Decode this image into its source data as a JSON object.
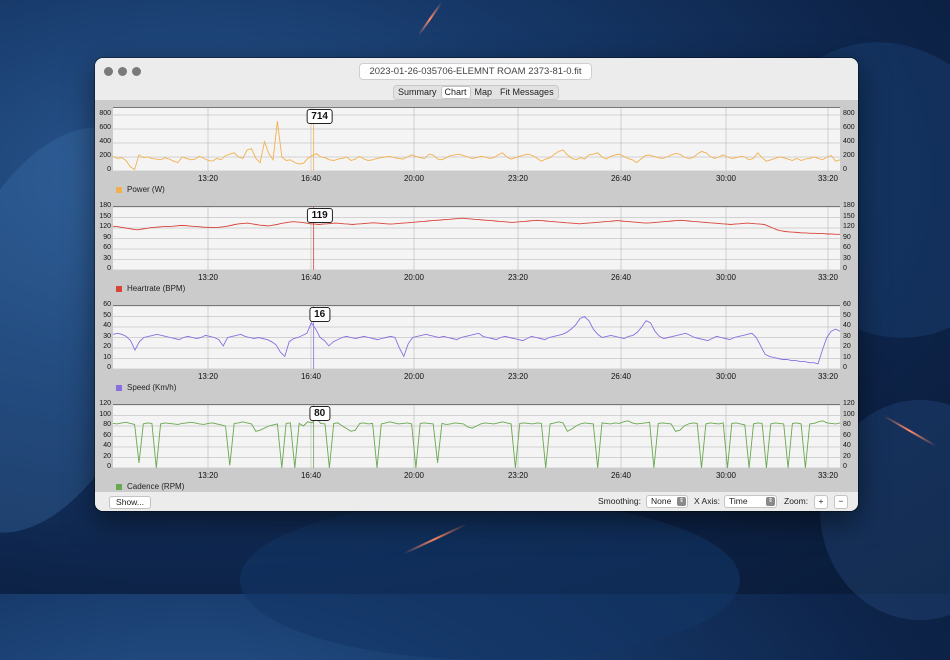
{
  "window": {
    "filename": "2023-01-26-035706-ELEMNT ROAM 2373-81-0.fit",
    "tabs": [
      {
        "label": "Summary",
        "selected": false
      },
      {
        "label": "Chart",
        "selected": true
      },
      {
        "label": "Map",
        "selected": false
      },
      {
        "label": "Fit Messages",
        "selected": false
      }
    ]
  },
  "charts": [
    {
      "key": "power",
      "legend": "Power (W)",
      "color": "#f2b14f",
      "yticks": [
        "800",
        "600",
        "400",
        "200",
        "0"
      ],
      "ymax": 900,
      "callout": "714",
      "xticks": [
        "13:20",
        "16:40",
        "20:00",
        "23:20",
        "26:40",
        "30:00",
        "33:20"
      ],
      "series": [
        210,
        180,
        190,
        150,
        60,
        20,
        230,
        190,
        200,
        180,
        170,
        160,
        190,
        170,
        140,
        120,
        200,
        180,
        160,
        170,
        210,
        180,
        150,
        140,
        180,
        160,
        220,
        240,
        260,
        200,
        180,
        300,
        320,
        180,
        120,
        420,
        250,
        160,
        714,
        200,
        150,
        160,
        120,
        100,
        110,
        180,
        220,
        250,
        200,
        190,
        160,
        150,
        170,
        180,
        200,
        150,
        170,
        210,
        170,
        150,
        160,
        180,
        190,
        200,
        210,
        190,
        180,
        170,
        200,
        230,
        210,
        190,
        180,
        240,
        230,
        170,
        160,
        190,
        220,
        230,
        240,
        220,
        200,
        180,
        190,
        210,
        200,
        180,
        190,
        230,
        260,
        200,
        170,
        190,
        210,
        230,
        240,
        220,
        180,
        140,
        170,
        190,
        240,
        280,
        300,
        230,
        180,
        160,
        190,
        170,
        230,
        240,
        260,
        200,
        170,
        210,
        230,
        240,
        210,
        180,
        160,
        120,
        170,
        220,
        230,
        210,
        190,
        180,
        200,
        230,
        250,
        240,
        200,
        180,
        190,
        240,
        280,
        260,
        210,
        180,
        200,
        230,
        200,
        180,
        190,
        210,
        200,
        160,
        180,
        260,
        190,
        140,
        160,
        180,
        200,
        190,
        170,
        150,
        180,
        150,
        170,
        180,
        200,
        180,
        160,
        200,
        220,
        140,
        160
      ]
    },
    {
      "key": "heartrate",
      "legend": "Heartrate (BPM)",
      "color": "#d9433a",
      "yticks": [
        "180",
        "150",
        "120",
        "90",
        "60",
        "30",
        "0"
      ],
      "ymax": 180,
      "callout": "119",
      "xticks": [
        "13:20",
        "16:40",
        "20:00",
        "23:20",
        "26:40",
        "30:00",
        "33:20"
      ],
      "series": [
        125,
        124,
        122,
        120,
        118,
        116,
        115,
        117,
        119,
        121,
        122,
        123,
        124,
        124,
        125,
        126,
        127,
        127,
        126,
        125,
        124,
        123,
        122,
        122,
        121,
        122,
        123,
        125,
        127,
        130,
        132,
        133,
        134,
        132,
        130,
        128,
        127,
        126,
        128,
        130,
        133,
        135,
        137,
        138,
        137,
        136,
        134,
        132,
        131,
        130,
        131,
        132,
        133,
        134,
        133,
        132,
        131,
        130,
        131,
        132,
        133,
        134,
        135,
        134,
        133,
        132,
        131,
        132,
        133,
        134,
        135,
        136,
        137,
        138,
        139,
        140,
        141,
        142,
        143,
        144,
        145,
        146,
        147,
        148,
        147,
        146,
        145,
        144,
        143,
        142,
        141,
        140,
        139,
        138,
        137,
        136,
        137,
        138,
        139,
        140,
        141,
        142,
        141,
        140,
        139,
        138,
        137,
        136,
        135,
        134,
        133,
        132,
        133,
        134,
        135,
        136,
        137,
        138,
        139,
        140,
        141,
        140,
        139,
        138,
        137,
        136,
        135,
        134,
        135,
        136,
        137,
        138,
        139,
        140,
        141,
        142,
        141,
        140,
        139,
        138,
        137,
        136,
        135,
        134,
        133,
        132,
        131,
        130,
        131,
        132,
        133,
        134,
        133,
        132,
        131,
        130,
        125,
        120,
        115,
        112,
        110,
        109,
        108,
        107,
        106,
        106,
        105,
        105,
        104,
        104,
        103,
        103,
        102,
        102
      ]
    },
    {
      "key": "speed",
      "legend": "Speed (Km/h)",
      "color": "#8b6fe0",
      "yticks": [
        "60",
        "50",
        "40",
        "30",
        "20",
        "10",
        "0"
      ],
      "ymax": 60,
      "callout": "16",
      "xticks": [
        "13:20",
        "16:40",
        "20:00",
        "23:20",
        "26:40",
        "30:00",
        "33:20"
      ],
      "series": [
        33,
        34,
        33,
        31,
        27,
        18,
        26,
        30,
        31,
        32,
        33,
        32,
        31,
        30,
        29,
        28,
        30,
        31,
        30,
        29,
        30,
        32,
        31,
        30,
        28,
        22,
        30,
        31,
        32,
        33,
        31,
        30,
        29,
        30,
        29,
        28,
        26,
        23,
        16,
        12,
        26,
        29,
        30,
        32,
        34,
        44,
        38,
        30,
        27,
        22,
        26,
        28,
        30,
        31,
        30,
        29,
        30,
        31,
        30,
        29,
        28,
        29,
        30,
        31,
        30,
        20,
        12,
        24,
        30,
        31,
        32,
        33,
        32,
        31,
        30,
        31,
        30,
        29,
        28,
        30,
        31,
        32,
        33,
        34,
        31,
        30,
        29,
        28,
        30,
        31,
        30,
        29,
        28,
        27,
        29,
        31,
        30,
        29,
        28,
        30,
        31,
        32,
        33,
        35,
        38,
        42,
        48,
        50,
        46,
        38,
        33,
        30,
        31,
        32,
        31,
        30,
        29,
        31,
        32,
        35,
        40,
        46,
        44,
        36,
        31,
        29,
        30,
        31,
        32,
        33,
        34,
        32,
        30,
        29,
        28,
        27,
        29,
        31,
        30,
        29,
        28,
        30,
        31,
        32,
        33,
        34,
        30,
        22,
        14,
        12,
        11,
        10,
        9,
        9,
        8,
        8,
        7,
        7,
        6,
        6,
        5,
        18,
        30,
        36,
        38,
        36
      ]
    },
    {
      "key": "cadence",
      "legend": "Cadence (RPM)",
      "color": "#6aa84f",
      "yticks": [
        "120",
        "100",
        "80",
        "60",
        "40",
        "20",
        "0"
      ],
      "ymax": 120,
      "callout": "80",
      "xticks": [
        "13:20",
        "16:40",
        "20:00",
        "23:20",
        "26:40",
        "30:00",
        "33:20"
      ],
      "series": [
        85,
        84,
        86,
        87,
        85,
        83,
        10,
        84,
        86,
        85,
        0,
        84,
        86,
        85,
        84,
        83,
        85,
        86,
        87,
        86,
        84,
        83,
        85,
        86,
        84,
        82,
        80,
        5,
        85,
        86,
        88,
        86,
        84,
        70,
        72,
        76,
        80,
        82,
        84,
        0,
        85,
        86,
        0,
        85,
        80,
        88,
        86,
        95,
        85,
        84,
        0,
        85,
        86,
        80,
        75,
        70,
        72,
        85,
        86,
        84,
        85,
        0,
        84,
        86,
        88,
        86,
        84,
        85,
        86,
        84,
        0,
        85,
        86,
        85,
        84,
        10,
        85,
        83,
        84,
        86,
        85,
        84,
        78,
        76,
        80,
        84,
        86,
        85,
        84,
        86,
        88,
        86,
        84,
        0,
        85,
        86,
        85,
        84,
        86,
        85,
        0,
        84,
        86,
        88,
        86,
        70,
        74,
        80,
        84,
        86,
        85,
        84,
        0,
        86,
        85,
        84,
        86,
        85,
        88,
        90,
        86,
        84,
        85,
        86,
        87,
        0,
        85,
        86,
        85,
        84,
        70,
        72,
        80,
        84,
        86,
        85,
        0,
        84,
        86,
        85,
        84,
        86,
        0,
        85,
        86,
        84,
        82,
        0,
        84,
        86,
        85,
        0,
        84,
        86,
        85,
        84,
        0,
        85,
        86,
        84,
        0,
        84,
        85,
        88,
        90,
        86,
        85,
        84,
        86
      ]
    }
  ],
  "controls": {
    "show_label": "Show...",
    "smoothing_label": "Smoothing:",
    "smoothing_value": "None",
    "xaxis_label": "X Axis:",
    "xaxis_value": "Time",
    "zoom_label": "Zoom:",
    "zoom_in": "+",
    "zoom_out": "−",
    "stepper_glyph": "⇕"
  }
}
